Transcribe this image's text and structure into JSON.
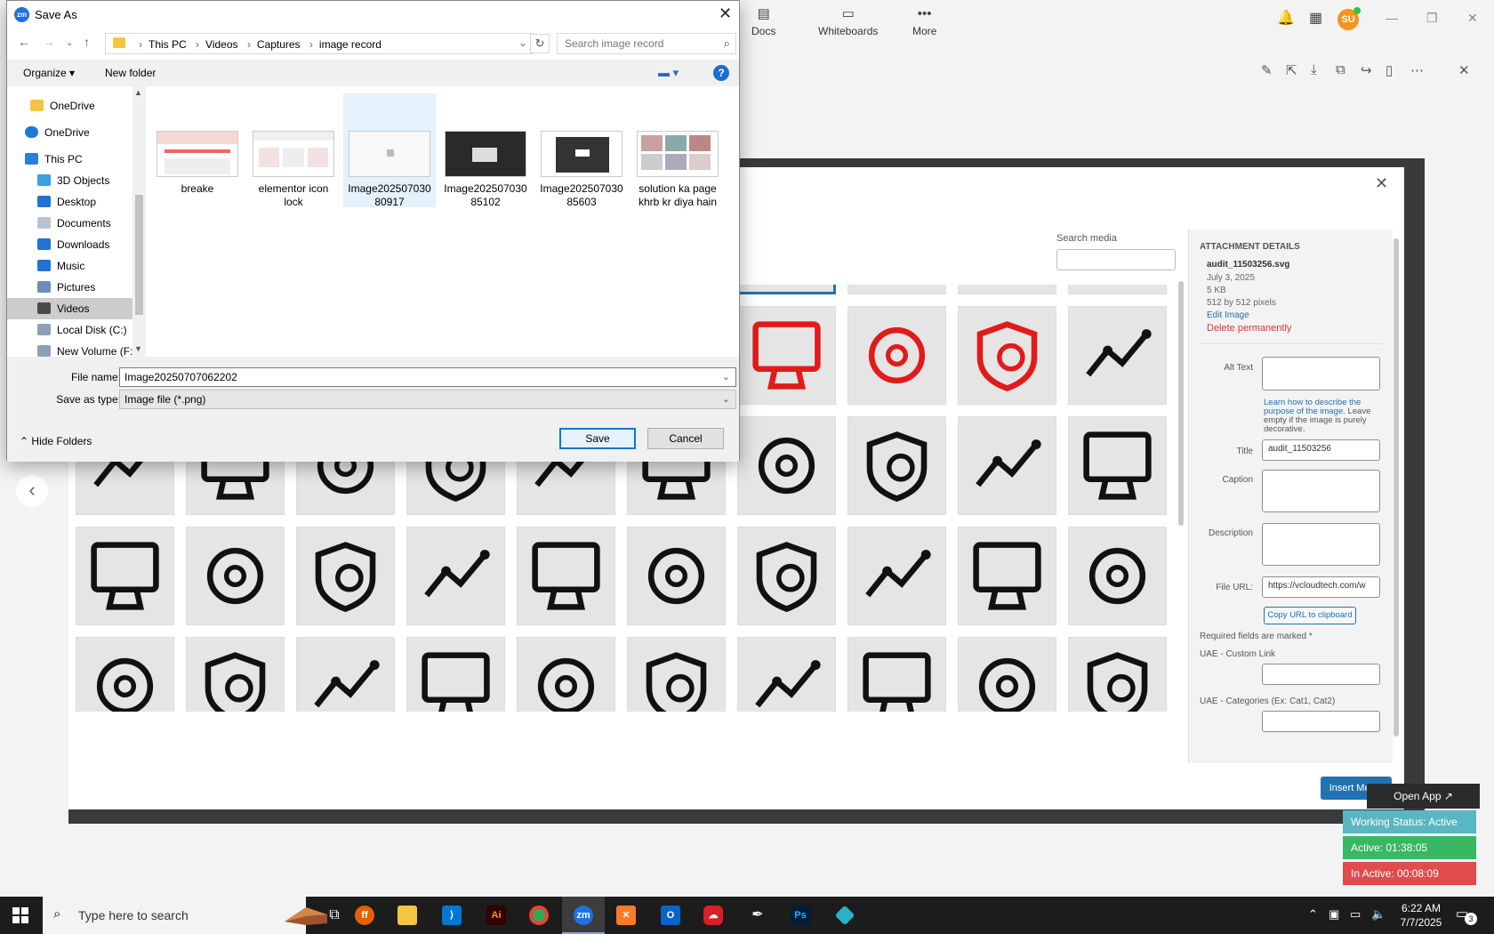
{
  "zoom": {
    "tabs": [
      {
        "label": "Docs",
        "icon": "doc-icon"
      },
      {
        "label": "Whiteboards",
        "icon": "whiteboard-icon"
      },
      {
        "label": "More",
        "icon": "more-icon"
      }
    ],
    "avatar": "SU"
  },
  "media": {
    "search_label": "Search media",
    "insert_label": "Insert Media",
    "details": {
      "header": "ATTACHMENT DETAILS",
      "filename": "audit_11503256.svg",
      "date": "July 3, 2025",
      "size": "5 KB",
      "dimensions": "512 by 512 pixels",
      "edit": "Edit Image",
      "delete": "Delete permanently",
      "alt_label": "Alt Text",
      "alt_help_link": "Learn how to describe the purpose of the image.",
      "alt_help_rest": " Leave empty if the image is purely decorative.",
      "title_label": "Title",
      "title_value": "audit_11503256",
      "caption_label": "Caption",
      "description_label": "Description",
      "url_label": "File URL:",
      "url_value": "https://vcloudtech.com/w",
      "copy_label": "Copy URL to clipboard",
      "required_note": "Required fields are marked *",
      "custom_link_label": "UAE - Custom Link",
      "categories_label": "UAE - Categories (Ex: Cat1, Cat2)"
    }
  },
  "tracker": {
    "open_app": "Open App ↗",
    "status": "Working Status: Active",
    "active": "Active: 01:38:05",
    "inactive": "In Active: 00:08:09"
  },
  "dialog": {
    "title": "Save As",
    "breadcrumb": [
      "This PC",
      "Videos",
      "Captures",
      "image record"
    ],
    "search_placeholder": "Search image record",
    "organize": "Organize ▾",
    "new_folder": "New folder",
    "nav": [
      {
        "label": "OneDrive",
        "icon": "folder-icon"
      },
      {
        "label": "OneDrive",
        "icon": "cloud-icon"
      },
      {
        "label": "This PC",
        "icon": "computer-icon"
      },
      {
        "label": "3D Objects",
        "icon": "cube-icon"
      },
      {
        "label": "Desktop",
        "icon": "desktop-icon"
      },
      {
        "label": "Documents",
        "icon": "document-icon"
      },
      {
        "label": "Downloads",
        "icon": "download-icon"
      },
      {
        "label": "Music",
        "icon": "music-icon"
      },
      {
        "label": "Pictures",
        "icon": "pictures-icon"
      },
      {
        "label": "Videos",
        "icon": "video-icon"
      },
      {
        "label": "Local Disk (C:)",
        "icon": "disk-icon"
      },
      {
        "label": "New Volume (F:)",
        "icon": "disk-icon"
      }
    ],
    "files": [
      {
        "label": "breake"
      },
      {
        "label": "elementor icon lock"
      },
      {
        "label": "Image20250703080917"
      },
      {
        "label": "Image20250703085102"
      },
      {
        "label": "Image20250703085603"
      },
      {
        "label": "solution ka page khrb kr diya hain"
      }
    ],
    "filename_label": "File name:",
    "filename_value": "Image20250707062202",
    "type_label": "Save as type:",
    "type_value": "Image file (*.png)",
    "hide_folders": "Hide Folders",
    "save": "Save",
    "cancel": "Cancel"
  },
  "taskbar": {
    "search_placeholder": "Type here to search",
    "time": "6:22 AM",
    "date": "7/7/2025",
    "notifications": "3"
  },
  "colors": {
    "accent": "#2271b1",
    "danger": "#d63638",
    "status_title": "#5ab6c2",
    "status_active": "#39b763",
    "status_inactive": "#e04b4b"
  }
}
